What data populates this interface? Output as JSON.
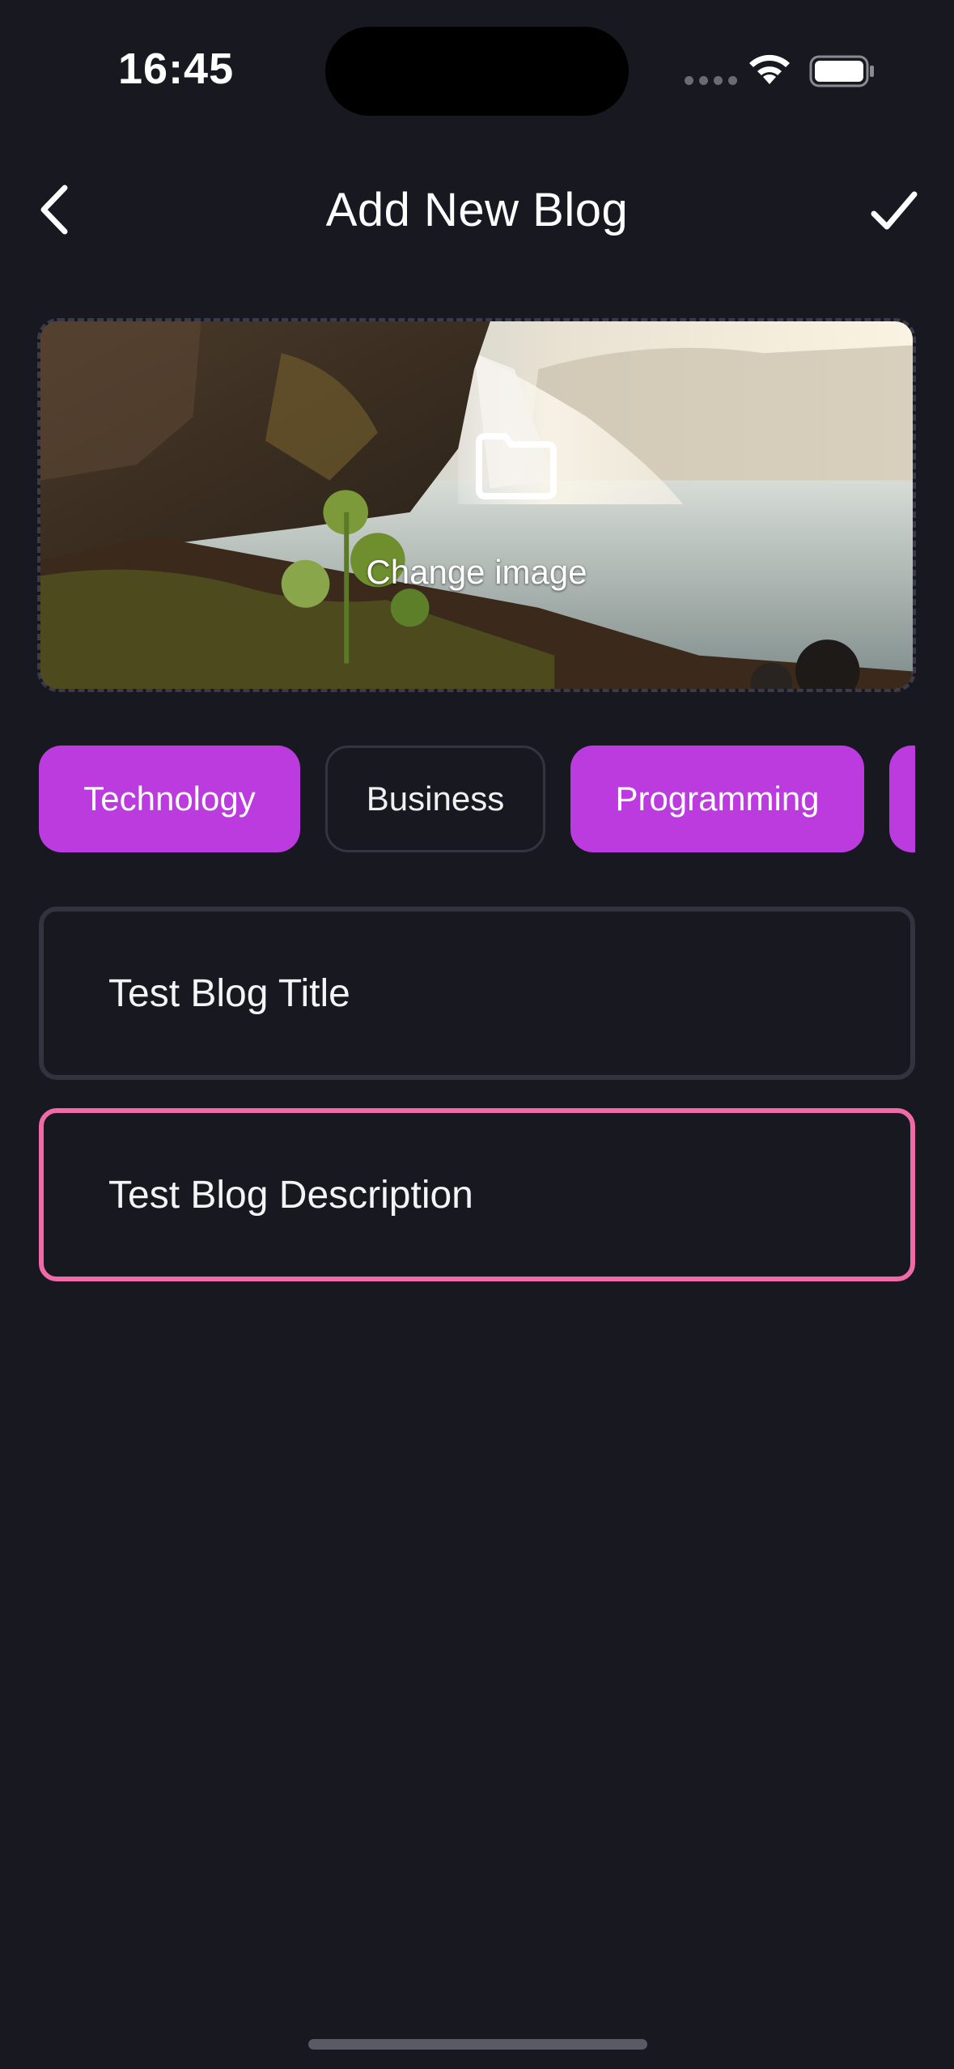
{
  "status_bar": {
    "time": "16:45"
  },
  "header": {
    "title": "Add New Blog",
    "back_icon": "chevron-left-icon",
    "confirm_icon": "checkmark-icon"
  },
  "image_picker": {
    "label": "Change image",
    "icon": "folder-icon"
  },
  "categories": [
    {
      "label": "Technology",
      "selected": true
    },
    {
      "label": "Business",
      "selected": false
    },
    {
      "label": "Programming",
      "selected": true
    },
    {
      "label": "",
      "selected": true
    }
  ],
  "form": {
    "title_value": "Test Blog Title",
    "description_value": "Test Blog Description"
  },
  "colors": {
    "background": "#181821",
    "chip_selected": "#bb3bdf",
    "focus_border": "#ef6aa7",
    "field_border": "#33333f"
  }
}
